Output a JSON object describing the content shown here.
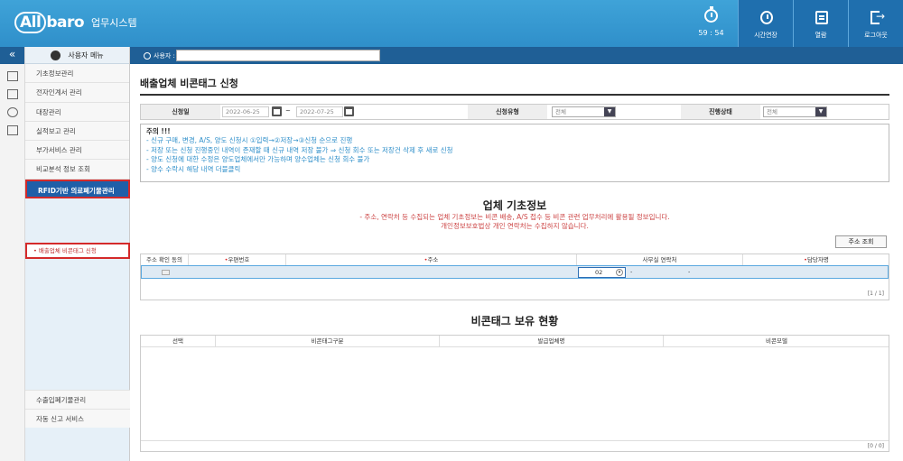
{
  "header": {
    "logo_text": "All",
    "logo_text2": "baro",
    "system_name": "업무시스템",
    "timer": "59 : 54",
    "buttons": [
      {
        "label": "시간연장",
        "icon": "clock-icon"
      },
      {
        "label": "열람",
        "icon": "document-icon"
      },
      {
        "label": "로그아웃",
        "icon": "logout-icon"
      }
    ]
  },
  "sidebar": {
    "menu_title": "사용자 메뉴",
    "items": [
      {
        "label": "기초정보관리"
      },
      {
        "label": "전자인계서 관리"
      },
      {
        "label": "대장관리"
      },
      {
        "label": "실적보고 관리"
      },
      {
        "label": "부가서비스 관리"
      },
      {
        "label": "비교분석 정보 조회"
      },
      {
        "label": "RFID기반 의료폐기물관리"
      }
    ],
    "sub_item": "배출업체 비콘태그 신청",
    "bottom_items": [
      {
        "label": "수출입폐기물관리"
      },
      {
        "label": "자동 신고 서비스"
      }
    ]
  },
  "topstrip": {
    "user_label": "사용자 :",
    "user_value": ""
  },
  "page": {
    "title": "배출업체 비콘태그 신청",
    "filter": {
      "date_label": "신청일",
      "date_from": "2022-06-25",
      "date_sep": "~",
      "date_to": "2022-07-25",
      "type_label": "신청유형",
      "type_value": "전체",
      "status_label": "진행상태",
      "status_value": "전체"
    },
    "notice": {
      "title": "주의 !!!",
      "lines": [
        "- 신규 구매, 변경, A/S, 양도 신청시 ①입력→②저장→③신청 순으로 진행",
        "- 저장 또는 신청 진행중인 내역이 존재할 때 신규 내역 저장 불가 ⇒ 신청 회수 또는 저장건 삭제 후 새로 신청",
        "- 양도 신청에 대한 수정은 양도업체에서만 가능하며 양수업체는 신청 회수 불가",
        "- 양수 수락시 해당 내역 더블클릭"
      ]
    },
    "company_section": {
      "title": "업체 기초정보",
      "sub1": "- 주소, 연락처 등 수집되는 업체 기초정보는 비콘 배송, A/S 접수 등 비콘 관련 업무처리에 활용될 정보입니다.",
      "sub2": "개인정보보호법상 개인 연락처는 수집하지 않습니다.",
      "addr_button": "주소 조회",
      "columns": [
        "주소 확인 동의",
        "우편번호",
        "주소",
        "사무실 연락처",
        "담당자명"
      ],
      "phone_prefix": "02",
      "phone_sep1": "-",
      "phone_sep2": "-",
      "count": "[1 / 1]"
    },
    "beacon_section": {
      "title": "비콘태그 보유 현황",
      "columns": [
        "선택",
        "비콘태그구분",
        "발급업체명",
        "비콘모델"
      ],
      "count": "[0 / 0]"
    }
  }
}
